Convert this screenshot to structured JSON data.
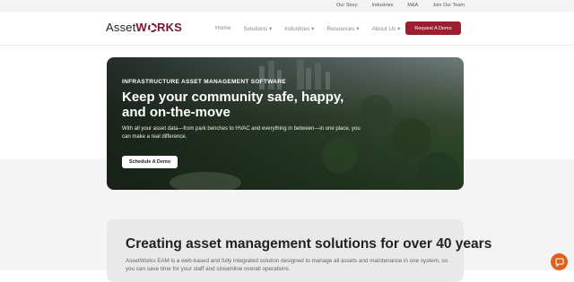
{
  "topbar": {
    "links": [
      "Our Story",
      "Industries",
      "M&A",
      "Join Our Team"
    ]
  },
  "header": {
    "logo_prefix": "Asset",
    "logo_suffix": "RKS",
    "nav": [
      "Home",
      "Solutions ▾",
      "Industries ▾",
      "Resources ▾",
      "About Us ▾"
    ],
    "cta_label": "Request A Demo"
  },
  "hero": {
    "eyebrow": "INFRASTRUCTURE ASSET MANAGEMENT SOFTWARE",
    "headline": "Keep your community safe, happy, and on-the-move",
    "subtext": "With all your asset data—from park benches to HVAC and everything in between—in one place, you can make a real difference.",
    "button_label": "Schedule A Demo"
  },
  "section": {
    "heading": "Creating asset management solutions for over 40 years",
    "body": "AssetWorks EAM is a web-based and fully integrated solution designed to manage all assets and maintenance in one system, so you can save time for your staff and streamline overall operations."
  },
  "colors": {
    "brand": "#7a1530",
    "cta": "#9b1f2e",
    "chat": "#e0611a"
  },
  "icons": {
    "chat": "chat-bubble-icon"
  }
}
